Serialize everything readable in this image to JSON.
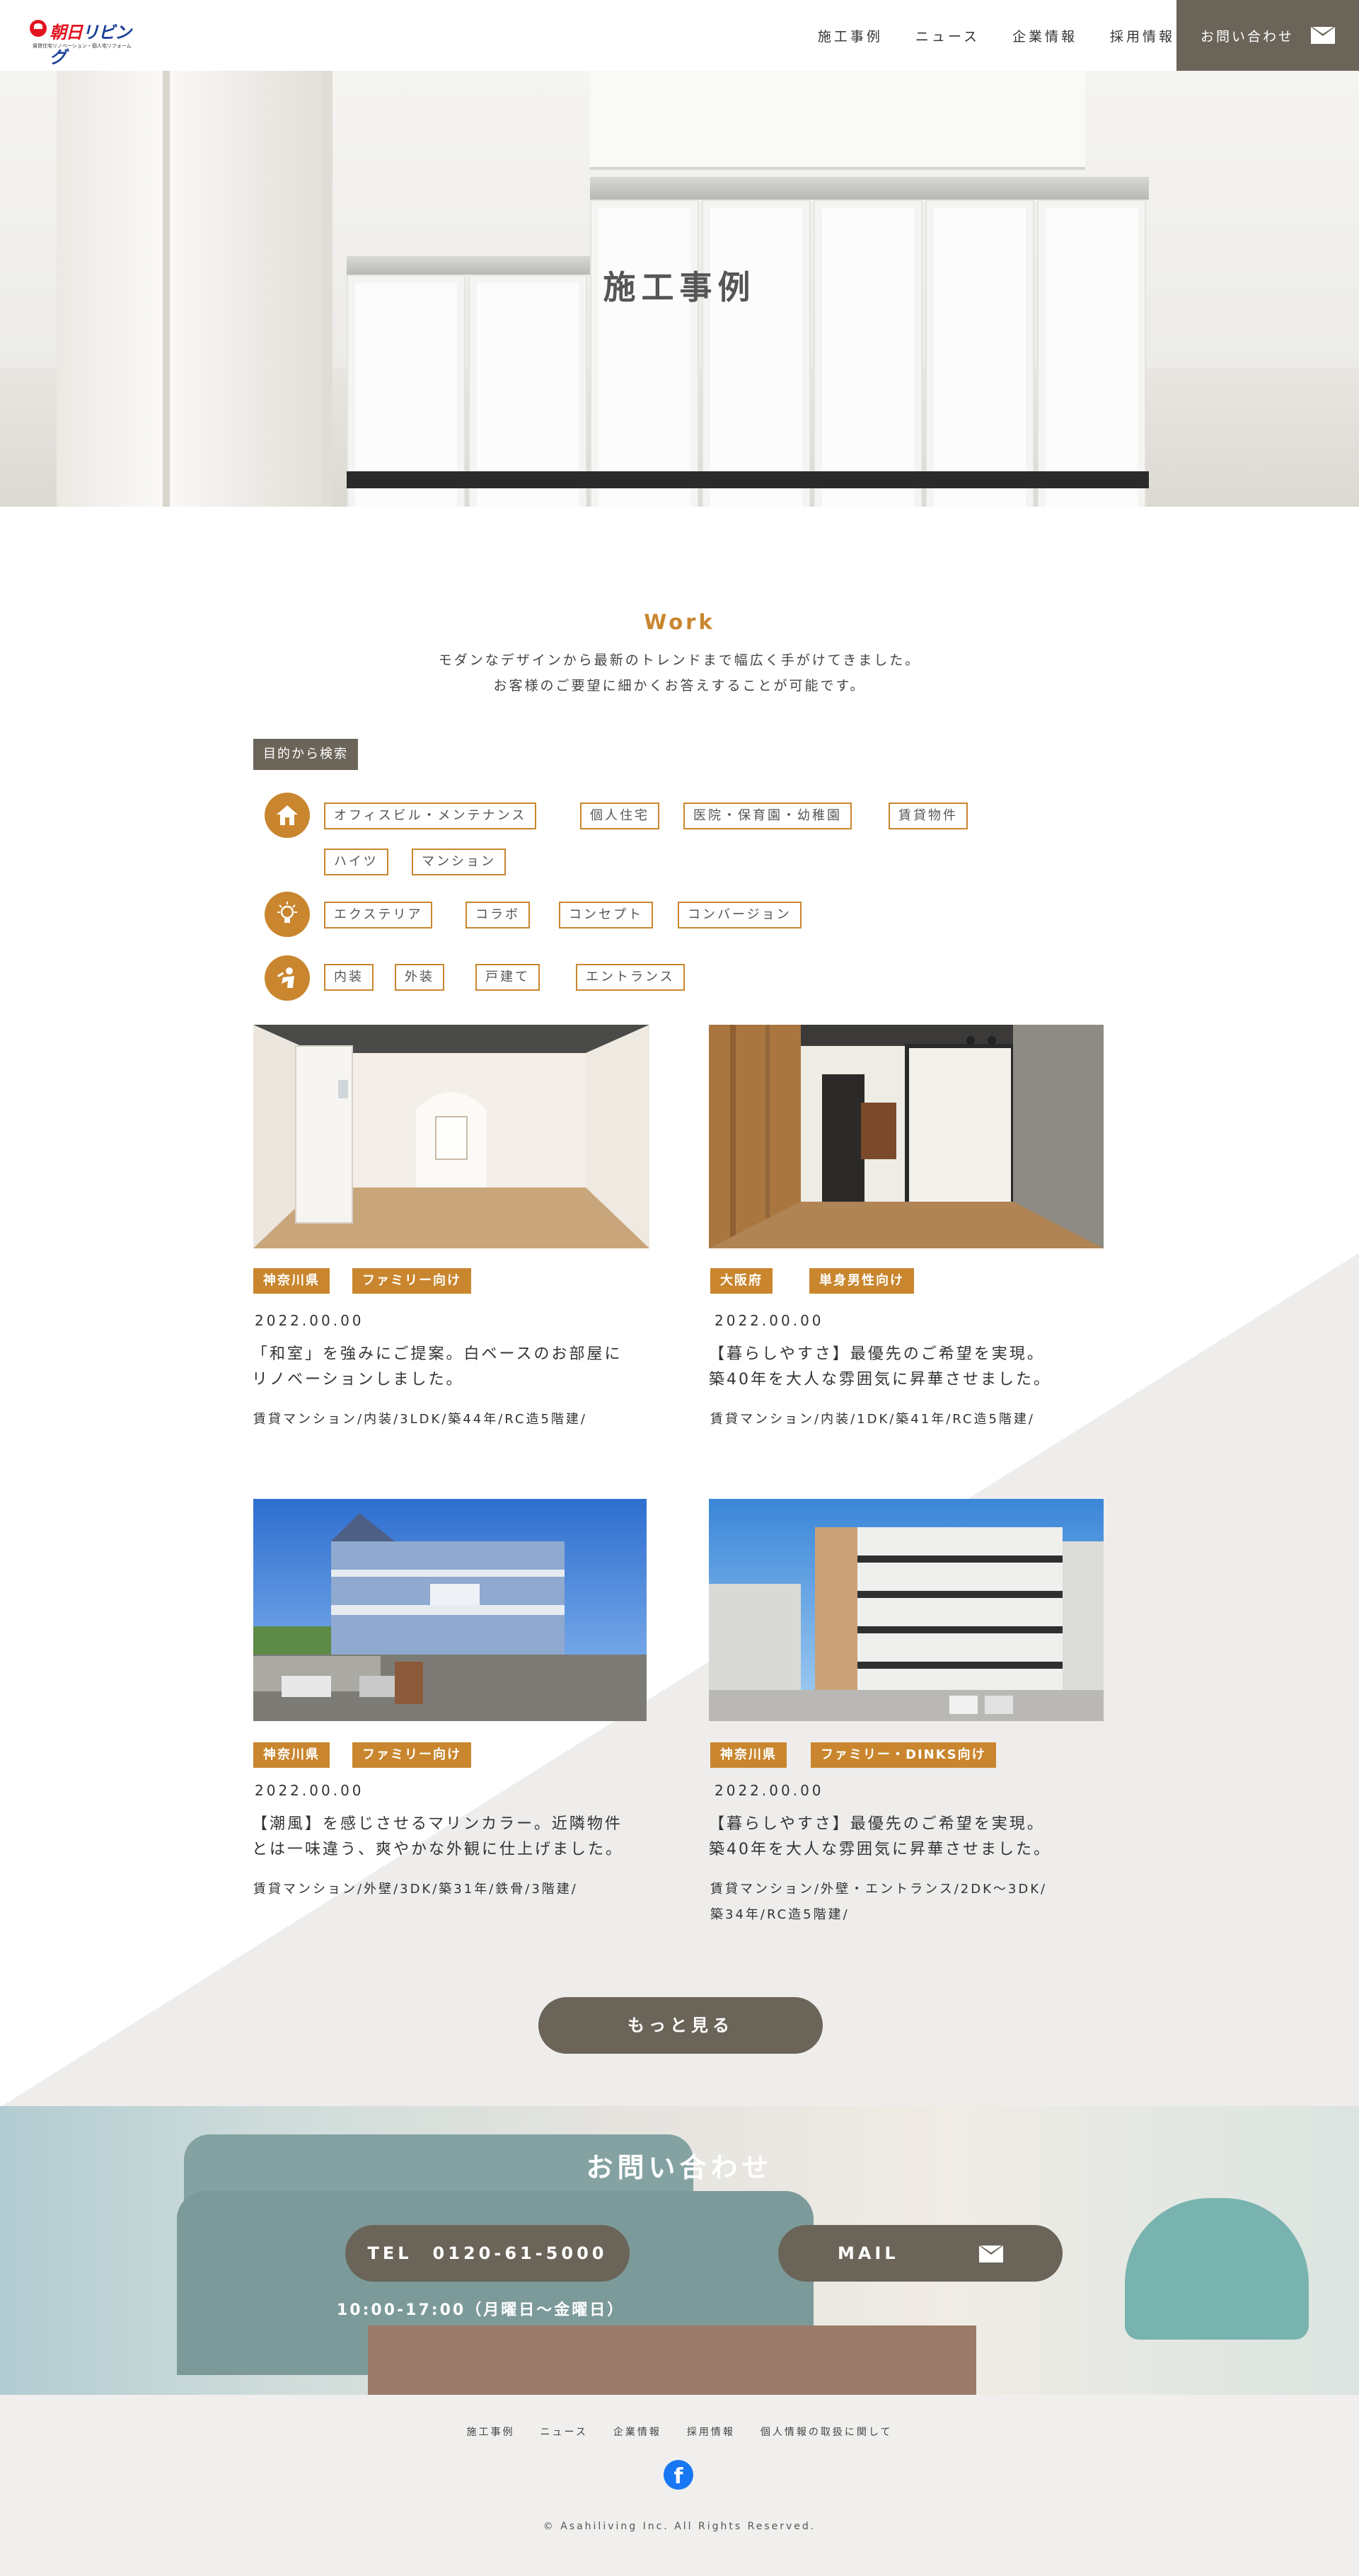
{
  "brand": {
    "logo_text_a": "朝日",
    "logo_text_b": "リビング",
    "logo_tagline": "賃貸住宅リノベーション・個人宅リフォーム"
  },
  "nav": {
    "items": [
      "施工事例",
      "ニュース",
      "企業情報",
      "採用情報"
    ],
    "contact_label": "お問い合わせ"
  },
  "hero": {
    "title": "施工事例"
  },
  "intro": {
    "title": "Work",
    "lead_1": "モダンなデザインから最新のトレンドまで幅広く手がけてきました。",
    "lead_2": "お客様のご要望に細かくお答えすることが可能です。"
  },
  "search": {
    "label": "目的から検索",
    "groups": [
      {
        "icon": "house-icon",
        "tags": [
          "オフィスビル・メンテナンス",
          "個人住宅",
          "医院・保育園・幼稚園",
          "賃貸物件",
          "ハイツ",
          "マンション"
        ]
      },
      {
        "icon": "lightbulb-icon",
        "tags": [
          "エクステリア",
          "コラボ",
          "コンセプト",
          "コンバージョン"
        ]
      },
      {
        "icon": "worker-icon",
        "tags": [
          "内装",
          "外装",
          "戸建て",
          "エントランス"
        ]
      }
    ]
  },
  "cards": [
    {
      "badges": [
        "神奈川県",
        "ファミリー向け"
      ],
      "date": "2022.00.00",
      "title_1": "「和室」を強みにご提案。白ベースのお部屋に",
      "title_2": "リノベーションしました。",
      "meta_1": "賃貸マンション/内装/3LDK/築44年/RC造5階建/",
      "meta_2": ""
    },
    {
      "badges": [
        "大阪府",
        "単身男性向け"
      ],
      "date": "2022.00.00",
      "title_1": "【暮らしやすさ】最優先のご希望を実現。",
      "title_2": "築40年を大人な雰囲気に昇華させました。",
      "meta_1": "賃貸マンション/内装/1DK/築41年/RC造5階建/",
      "meta_2": ""
    },
    {
      "badges": [
        "神奈川県",
        "ファミリー向け"
      ],
      "date": "2022.00.00",
      "title_1": "【潮風】を感じさせるマリンカラー。近隣物件",
      "title_2": "とは一味違う、爽やかな外観に仕上げました。",
      "meta_1": "賃貸マンション/外壁/3DK/築31年/鉄骨/3階建/",
      "meta_2": ""
    },
    {
      "badges": [
        "神奈川県",
        "ファミリー・DINKS向け"
      ],
      "date": "2022.00.00",
      "title_1": "【暮らしやすさ】最優先のご希望を実現。",
      "title_2": "築40年を大人な雰囲気に昇華させました。",
      "meta_1": "賃貸マンション/外壁・エントランス/2DK～3DK/",
      "meta_2": "築34年/RC造5階建/"
    }
  ],
  "more_label": "もっと見る",
  "contact": {
    "title": "お問い合わせ",
    "tel_label": "TEL　0120-61-5000",
    "mail_label": "MAIL",
    "hours": "10:00-17:00（月曜日～金曜日）"
  },
  "footer": {
    "links": [
      "施工事例",
      "ニュース",
      "企業情報",
      "採用情報",
      "個人情報の取扱に関して"
    ],
    "social_icon": "facebook-icon",
    "copyright": "© Asahiliving Inc. All Rights Reserved."
  },
  "colors": {
    "accent": "#c9862e",
    "dark": "#6b6459",
    "footer_bg": "#f0efed"
  }
}
